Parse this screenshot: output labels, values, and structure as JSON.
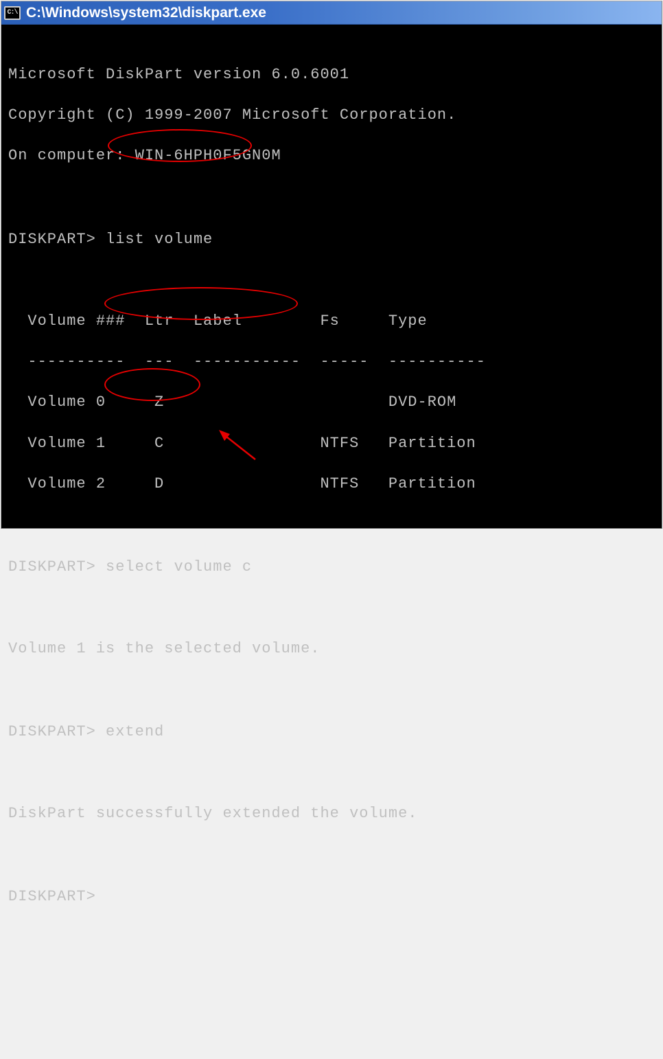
{
  "window": {
    "title": "C:\\Windows\\system32\\diskpart.exe",
    "icon_text": "C:\\"
  },
  "header": {
    "line1": "Microsoft DiskPart version 6.0.6001",
    "line2": "Copyright (C) 1999-2007 Microsoft Corporation.",
    "line3": "On computer: WIN-6HPH0F5GN0M"
  },
  "prompt": "DISKPART>",
  "commands": {
    "cmd1": "list volume",
    "cmd2": "select volume c",
    "cmd3": "extend"
  },
  "table": {
    "header": "  Volume ###  Ltr  Label        Fs     Type",
    "divider": "  ----------  ---  -----------  -----  ----------",
    "row0": "  Volume 0     Z                       DVD-ROM",
    "row1": "  Volume 1     C                NTFS   Partition",
    "row2": "  Volume 2     D                NTFS   Partition"
  },
  "messages": {
    "selected": "Volume 1 is the selected volume.",
    "extended": "DiskPart successfully extended the volume."
  }
}
